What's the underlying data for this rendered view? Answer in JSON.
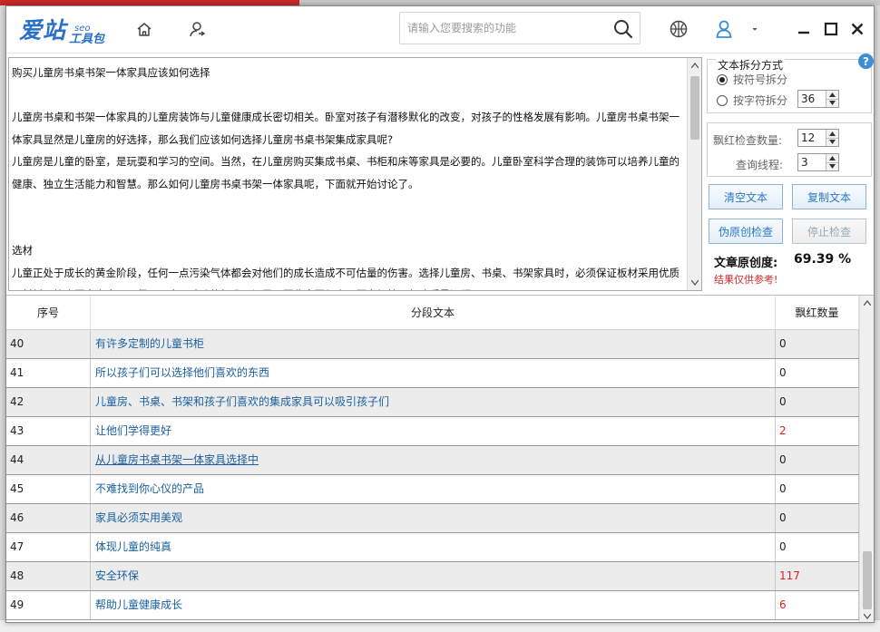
{
  "app": {
    "logo_main": "爱站",
    "logo_seo": "seo",
    "logo_tool": "工具包"
  },
  "search": {
    "placeholder": "请输入您要搜索的功能"
  },
  "article": {
    "text": "购买儿童房书桌书架一体家具应该如何选择\n\n儿童房书桌和书架一体家具的儿童房装饰与儿童健康成长密切相关。卧室对孩子有潜移默化的改变，对孩子的性格发展有影响。儿童房书桌书架一体家具显然是儿童房的好选择，那么我们应该如何选择儿童房书桌书架集成家具呢?\n儿童房是儿童的卧室，是玩耍和学习的空间。当然，在儿童房购买集成书桌、书柜和床等家具是必要的。儿童卧室科学合理的装饰可以培养儿童的健康、独立生活能力和智慧。那么如何儿童房书桌书架一体家具呢，下面就开始讨论了。\n\n\n选材\n儿童正处于成长的黄金阶段，任何一点污染气体都会对他们的成长造成不可估量的伤害。选择儿童房、书桌、书架家具时，必须保证板材采用优质原材料，符合国家安全、环保、无毒、味淡的标准，切忌不要业贪图便宜，顾多轻抽，忽略质量问题。"
  },
  "split": {
    "title": "文本拆分方式",
    "option_symbol": "按符号拆分",
    "option_chars": "按字符拆分",
    "chars_value": "36"
  },
  "check": {
    "count_label": "飘红检查数量:",
    "count_value": "12",
    "threads_label": "查询线程:",
    "threads_value": "3"
  },
  "buttons": {
    "clear": "清空文本",
    "copy": "复制文本",
    "check": "伪原创检查",
    "stop": "停止检查"
  },
  "result": {
    "label": "文章原创度:",
    "value": "69.39 %",
    "note": "结果仅供参考!"
  },
  "table": {
    "headers": [
      "序号",
      "分段文本",
      "飘红数量"
    ],
    "rows": [
      {
        "no": "40",
        "text": "有许多定制的儿童书柜",
        "count": "0",
        "red": false,
        "link": false
      },
      {
        "no": "41",
        "text": "所以孩子们可以选择他们喜欢的东西",
        "count": "0",
        "red": false,
        "link": false
      },
      {
        "no": "42",
        "text": "儿童房、书桌、书架和孩子们喜欢的集成家具可以吸引孩子们",
        "count": "0",
        "red": false,
        "link": false
      },
      {
        "no": "43",
        "text": "让他们学得更好",
        "count": "2",
        "red": true,
        "link": false
      },
      {
        "no": "44",
        "text": "从儿童房书桌书架一体家具选择中",
        "count": "0",
        "red": false,
        "link": true
      },
      {
        "no": "45",
        "text": "不难找到你心仪的产品",
        "count": "0",
        "red": false,
        "link": false
      },
      {
        "no": "46",
        "text": "家具必须实用美观",
        "count": "0",
        "red": false,
        "link": false
      },
      {
        "no": "47",
        "text": "体现儿童的纯真",
        "count": "0",
        "red": false,
        "link": false
      },
      {
        "no": "48",
        "text": "安全环保",
        "count": "117",
        "red": true,
        "link": false
      },
      {
        "no": "49",
        "text": "帮助儿童健康成长",
        "count": "6",
        "red": true,
        "link": false
      }
    ]
  },
  "colors": {
    "brand_blue": "#2a6fc9",
    "link_blue": "#1a5f9e",
    "alert_red": "#e0201d"
  },
  "icons": [
    "home-icon",
    "user-switch-icon",
    "search-icon",
    "basketball-icon",
    "user-icon",
    "minimize-icon",
    "maximize-icon",
    "close-icon",
    "help-icon"
  ]
}
